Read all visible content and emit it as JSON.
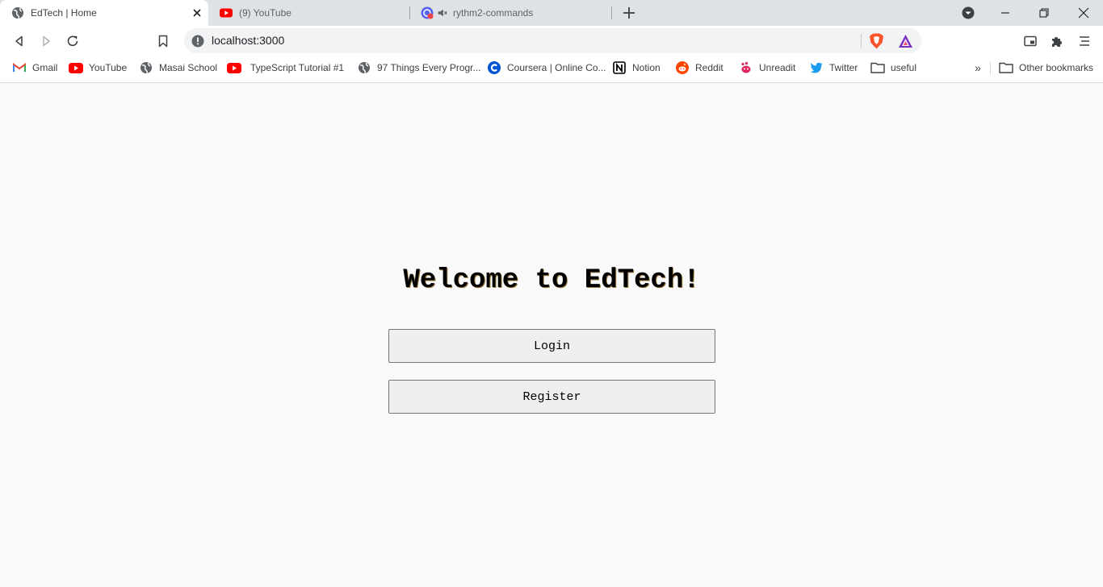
{
  "tabs": [
    {
      "title": "EdTech | Home",
      "active": true
    },
    {
      "title": "(9) YouTube",
      "active": false
    },
    {
      "title": "rythm2-commands",
      "active": false
    }
  ],
  "toolbar": {
    "url": "localhost:3000"
  },
  "bookmarks": [
    {
      "label": "Gmail",
      "icon": "gmail-icon"
    },
    {
      "label": "YouTube",
      "icon": "youtube-icon"
    },
    {
      "label": "Masai School",
      "icon": "globe-icon"
    },
    {
      "label": "TypeScript Tutorial #1",
      "icon": "youtube-icon"
    },
    {
      "label": "97 Things Every Progr...",
      "icon": "globe-icon"
    },
    {
      "label": "Coursera | Online Co...",
      "icon": "coursera-icon"
    },
    {
      "label": "Notion",
      "icon": "notion-icon"
    },
    {
      "label": "Reddit",
      "icon": "reddit-icon"
    },
    {
      "label": "Unreadit",
      "icon": "unreadit-icon"
    },
    {
      "label": "Twitter",
      "icon": "twitter-icon"
    },
    {
      "label": "useful",
      "icon": "folder-icon"
    }
  ],
  "bookmarks_overflow": "»",
  "other_bookmarks": "Other bookmarks",
  "main": {
    "heading": "Welcome to EdTech!",
    "login_label": "Login",
    "register_label": "Register"
  },
  "colors": {
    "tabstrip": "#dee1e6",
    "page_background": "#f9f9f9",
    "button_background": "#efefef",
    "button_border": "#767676",
    "youtube_red": "#ff0000",
    "twitter_blue": "#1d9bf0"
  }
}
